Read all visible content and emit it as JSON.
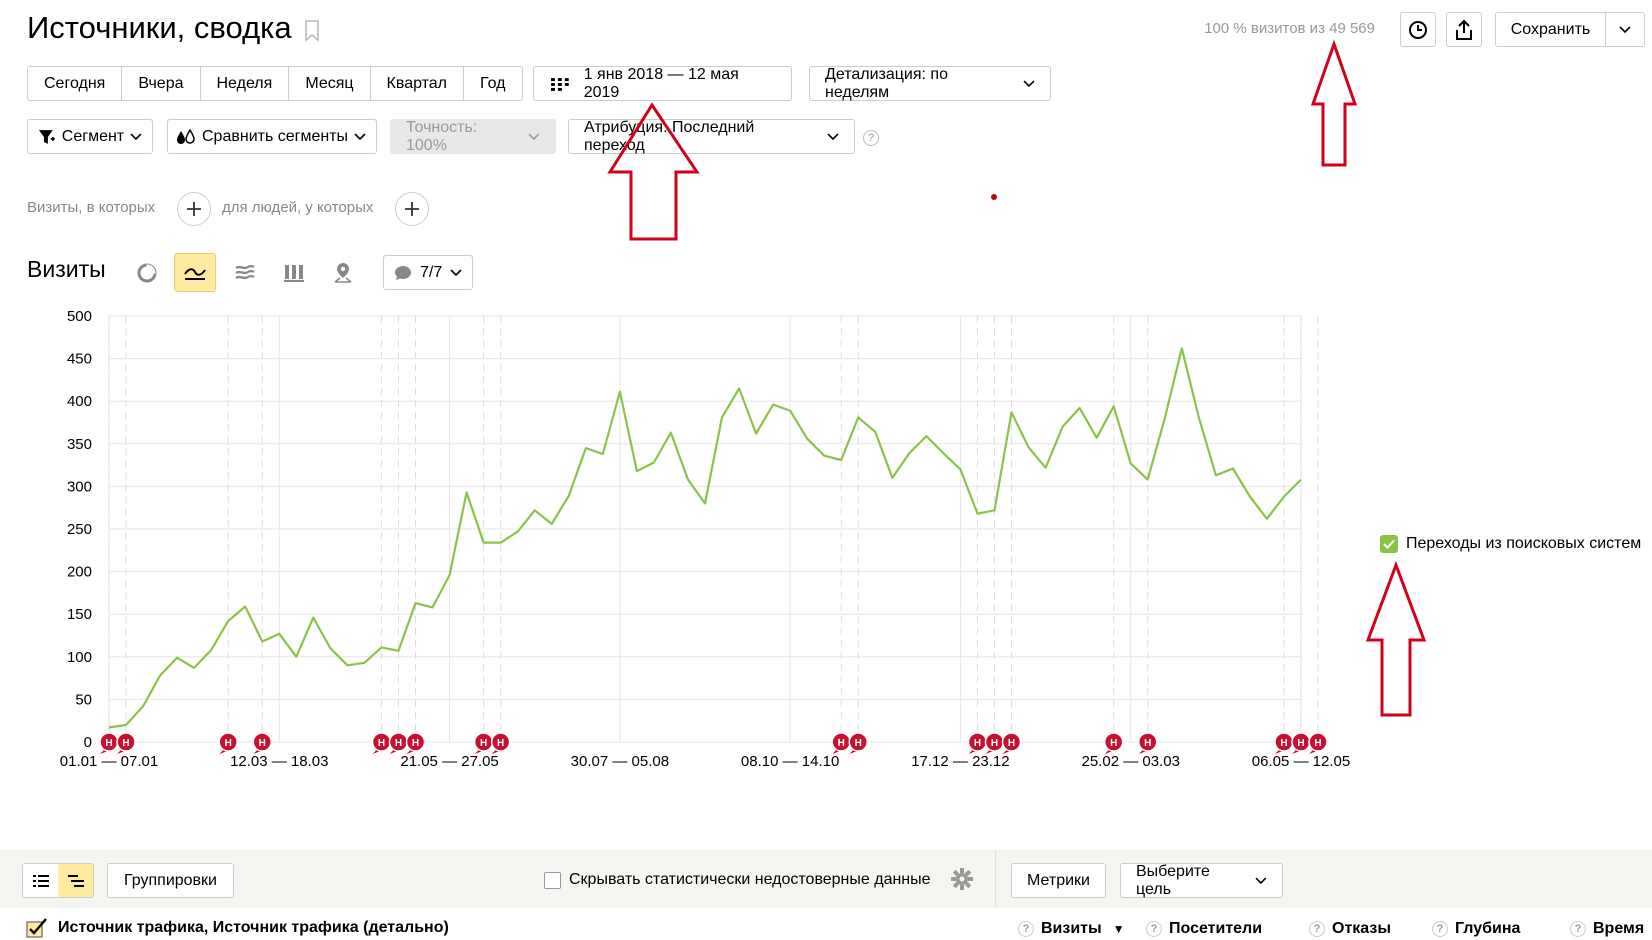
{
  "header": {
    "title": "Источники, сводка",
    "visits_info": "100 % визитов из 49 569",
    "save_label": "Сохранить"
  },
  "periods": [
    "Сегодня",
    "Вчера",
    "Неделя",
    "Месяц",
    "Квартал",
    "Год"
  ],
  "date_range": "1 янв 2018 — 12 мая 2019",
  "detail": "Детализация: по неделям",
  "filters": {
    "segment": "Сегмент",
    "compare": "Сравнить сегменты",
    "accuracy": "Точность: 100%",
    "attribution": "Атрибуция: Последний переход",
    "help": "?"
  },
  "segment_builder": {
    "visits_label": "Визиты, в которых",
    "people_label": "для людей, у которых"
  },
  "chart_section": {
    "title": "Визиты",
    "comments": "7/7"
  },
  "legend": {
    "label": "Переходы из поисковых систем"
  },
  "colors": {
    "line": "#8bc34a",
    "marker": "#c8102e",
    "grid": "#e6e6e6",
    "arrow": "#d0021b"
  },
  "chart_data": {
    "type": "line",
    "title": "",
    "xlabel": "",
    "ylabel": "",
    "ylim": [
      0,
      500
    ],
    "yticks": [
      0,
      50,
      100,
      150,
      200,
      250,
      300,
      350,
      400,
      450,
      500
    ],
    "x_tick_labels": [
      "01.01 — 07.01",
      "12.03 — 18.03",
      "21.05 — 27.05",
      "30.07 — 05.08",
      "08.10 — 14.10",
      "17.12 — 23.12",
      "25.02 — 03.03",
      "06.05 — 12.05"
    ],
    "x_tick_indices": [
      0,
      10,
      20,
      30,
      40,
      50,
      60,
      70
    ],
    "series": [
      {
        "name": "Переходы из поисковых систем",
        "values": [
          17,
          20,
          42,
          78,
          99,
          87,
          108,
          142,
          159,
          118,
          127,
          100,
          146,
          110,
          90,
          93,
          111,
          107,
          163,
          158,
          196,
          293,
          234,
          234,
          247,
          272,
          256,
          289,
          345,
          338,
          411,
          318,
          328,
          363,
          308,
          280,
          381,
          415,
          362,
          396,
          389,
          356,
          336,
          331,
          381,
          364,
          310,
          339,
          359,
          339,
          320,
          268,
          272,
          387,
          346,
          322,
          370,
          392,
          357,
          394,
          327,
          308,
          380,
          462,
          381,
          313,
          321,
          288,
          262,
          288,
          308
        ]
      }
    ],
    "annotation_marker_label": "Н",
    "annotations": [
      0,
      1,
      7,
      9,
      16,
      17,
      18,
      22,
      23,
      43,
      44,
      51,
      52,
      53,
      59,
      61,
      69,
      70,
      71
    ]
  },
  "table_toolbar": {
    "groupings": "Группировки",
    "hide_unreliable": "Скрывать статистически недостоверные данные",
    "metrics": "Метрики",
    "choose_goal": "Выберите цель"
  },
  "table_header": {
    "dimension": "Источник трафика, Источник трафика (детально)",
    "columns": [
      "Визиты",
      "Посетители",
      "Отказы",
      "Глубина",
      "Время"
    ],
    "sort_indicator": "▼"
  }
}
